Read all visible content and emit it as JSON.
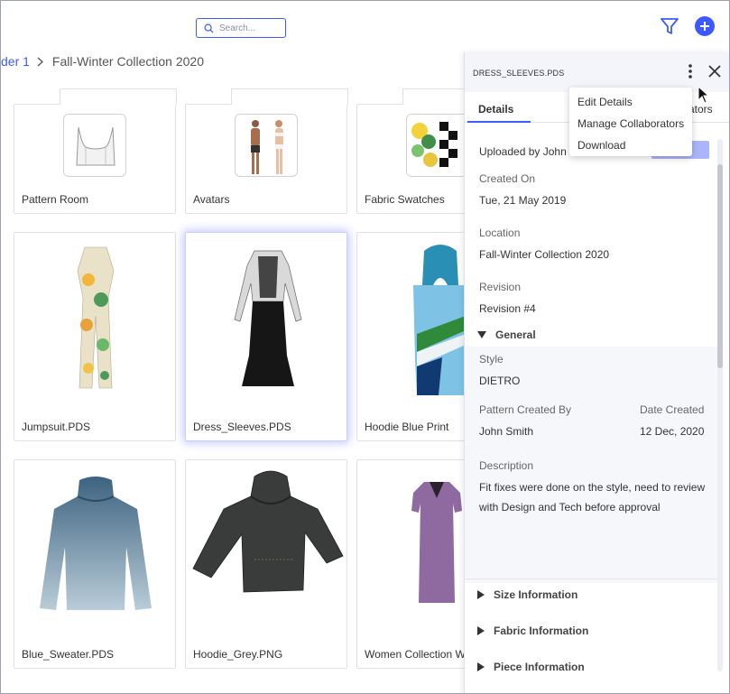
{
  "search": {
    "placeholder": "Search..."
  },
  "icons": {
    "search": "search-icon",
    "filter": "filter-icon",
    "add": "plus-circle-icon",
    "chevron": "chevron-right-icon",
    "more": "more-vertical-icon",
    "close": "close-icon",
    "expanded": "triangle-down-icon",
    "collapsed": "triangle-right-icon"
  },
  "colors": {
    "accent": "#3d5afe",
    "selected_glow": "#6a7cff"
  },
  "breadcrumb": {
    "parent": "der 1",
    "current": "Fall-Winter Collection 2020"
  },
  "grid": {
    "folders": [
      {
        "label": "Pattern Room"
      },
      {
        "label": "Avatars"
      },
      {
        "label": "Fabric Swatches"
      }
    ],
    "files": [
      {
        "label": "Jumpsuit.PDS"
      },
      {
        "label": "Dress_Sleeves.PDS"
      },
      {
        "label": "Hoodie Blue Print"
      },
      {
        "label": "Blue_Sweater.PDS"
      },
      {
        "label": "Hoodie_Grey.PNG"
      },
      {
        "label": "Women Collection W"
      }
    ]
  },
  "panel": {
    "title": "DRESS_SLEEVES.PDS",
    "tabs": {
      "details": "Details",
      "collaborators": "ators"
    },
    "uploaded_by": "Uploaded by John",
    "created_on_label": "Created On",
    "created_on": "Tue, 21 May 2019",
    "location_label": "Location",
    "location": "Fall-Winter Collection 2020",
    "revision_label": "Revision",
    "revision": "Revision #4",
    "general_label": "General",
    "style_label": "Style",
    "style": "DIETRO",
    "pattern_created_by_label": "Pattern Created By",
    "pattern_created_by": "John Smith",
    "date_created_label": "Date Created",
    "date_created": "12 Dec, 2020",
    "description_label": "Description",
    "description": "Fit fixes were done on the style, need to review with Design and Tech before approval",
    "sections": [
      "Size Information",
      "Fabric Information",
      "Piece Information"
    ]
  },
  "menu": {
    "items": [
      "Edit Details",
      "Manage Collaborators",
      "Download"
    ]
  }
}
